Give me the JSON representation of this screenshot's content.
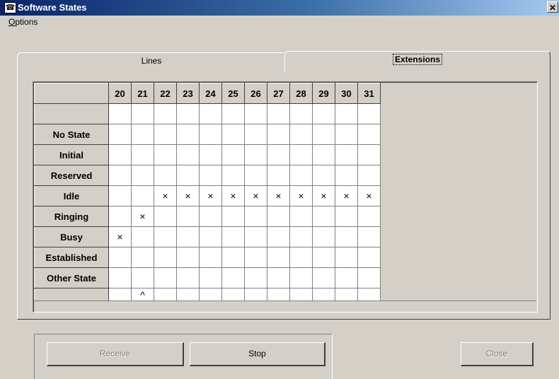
{
  "window": {
    "title": "Software States",
    "icon": "telephone-icon",
    "close_glyph": "✕"
  },
  "menu": {
    "options_label": "Options"
  },
  "tabs": {
    "lines_label": "Lines",
    "extensions_label": "Extensions",
    "selected": "Extensions"
  },
  "grid": {
    "columns": [
      "20",
      "21",
      "22",
      "23",
      "24",
      "25",
      "26",
      "27",
      "28",
      "29",
      "30",
      "31"
    ],
    "rows": [
      {
        "label": "",
        "cells": [
          "",
          "",
          "",
          "",
          "",
          "",
          "",
          "",
          "",
          "",
          "",
          ""
        ]
      },
      {
        "label": "No State",
        "cells": [
          "",
          "",
          "",
          "",
          "",
          "",
          "",
          "",
          "",
          "",
          "",
          ""
        ]
      },
      {
        "label": "Initial",
        "cells": [
          "",
          "",
          "",
          "",
          "",
          "",
          "",
          "",
          "",
          "",
          "",
          ""
        ]
      },
      {
        "label": "Reserved",
        "cells": [
          "",
          "",
          "",
          "",
          "",
          "",
          "",
          "",
          "",
          "",
          "",
          ""
        ]
      },
      {
        "label": "Idle",
        "cells": [
          "",
          "",
          "×",
          "×",
          "×",
          "×",
          "×",
          "×",
          "×",
          "×",
          "×",
          "×"
        ]
      },
      {
        "label": "Ringing",
        "cells": [
          "",
          "×",
          "",
          "",
          "",
          "",
          "",
          "",
          "",
          "",
          "",
          ""
        ]
      },
      {
        "label": "Busy",
        "cells": [
          "×",
          "",
          "",
          "",
          "",
          "",
          "",
          "",
          "",
          "",
          "",
          ""
        ]
      },
      {
        "label": "Established",
        "cells": [
          "",
          "",
          "",
          "",
          "",
          "",
          "",
          "",
          "",
          "",
          "",
          ""
        ]
      },
      {
        "label": "Other State",
        "cells": [
          "",
          "",
          "",
          "",
          "",
          "",
          "",
          "",
          "",
          "",
          "",
          ""
        ]
      },
      {
        "label": "",
        "cells": [
          "",
          "^",
          "",
          "",
          "",
          "",
          "",
          "",
          "",
          "",
          "",
          ""
        ]
      }
    ]
  },
  "buttons": {
    "receive_label": "Receive",
    "stop_label": "Stop",
    "close_label": "Close"
  }
}
